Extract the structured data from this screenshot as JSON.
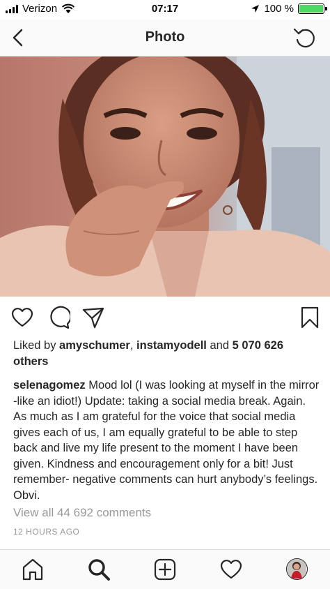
{
  "status_bar": {
    "carrier": "Verizon",
    "time": "07:17",
    "battery_percent": "100 %",
    "battery_level": 1.0,
    "battery_color": "#4cd964"
  },
  "navbar": {
    "title": "Photo",
    "back_icon": "chevron-left-icon",
    "refresh_icon": "refresh-icon"
  },
  "post": {
    "likes_prefix": "Liked by ",
    "liker_1": "amyschumer",
    "likes_sep": ", ",
    "liker_2": "instamyodell",
    "likes_and": " and ",
    "likes_count": "5 070 626 others",
    "author": "selenagomez",
    "caption": " Mood lol (I was looking at myself in the mirror -like an idiot!) Update: taking a social media break. Again. As much as I am grateful for the voice that social media gives each of us, I am equally grateful to be able to step back and live my life present to the moment I have been given. Kindness and encouragement only for a bit! Just remember- negative comments can hurt anybody’s feelings. Obvi.",
    "view_comments": "View all 44 692 comments",
    "time_ago": "12 HOURS AGO"
  },
  "actions": {
    "icons": [
      "heart-icon",
      "comment-icon",
      "share-icon",
      "bookmark-icon"
    ]
  },
  "tabbar": {
    "icons": [
      "home-icon",
      "search-icon",
      "add-post-icon",
      "activity-icon",
      "profile-avatar"
    ]
  }
}
